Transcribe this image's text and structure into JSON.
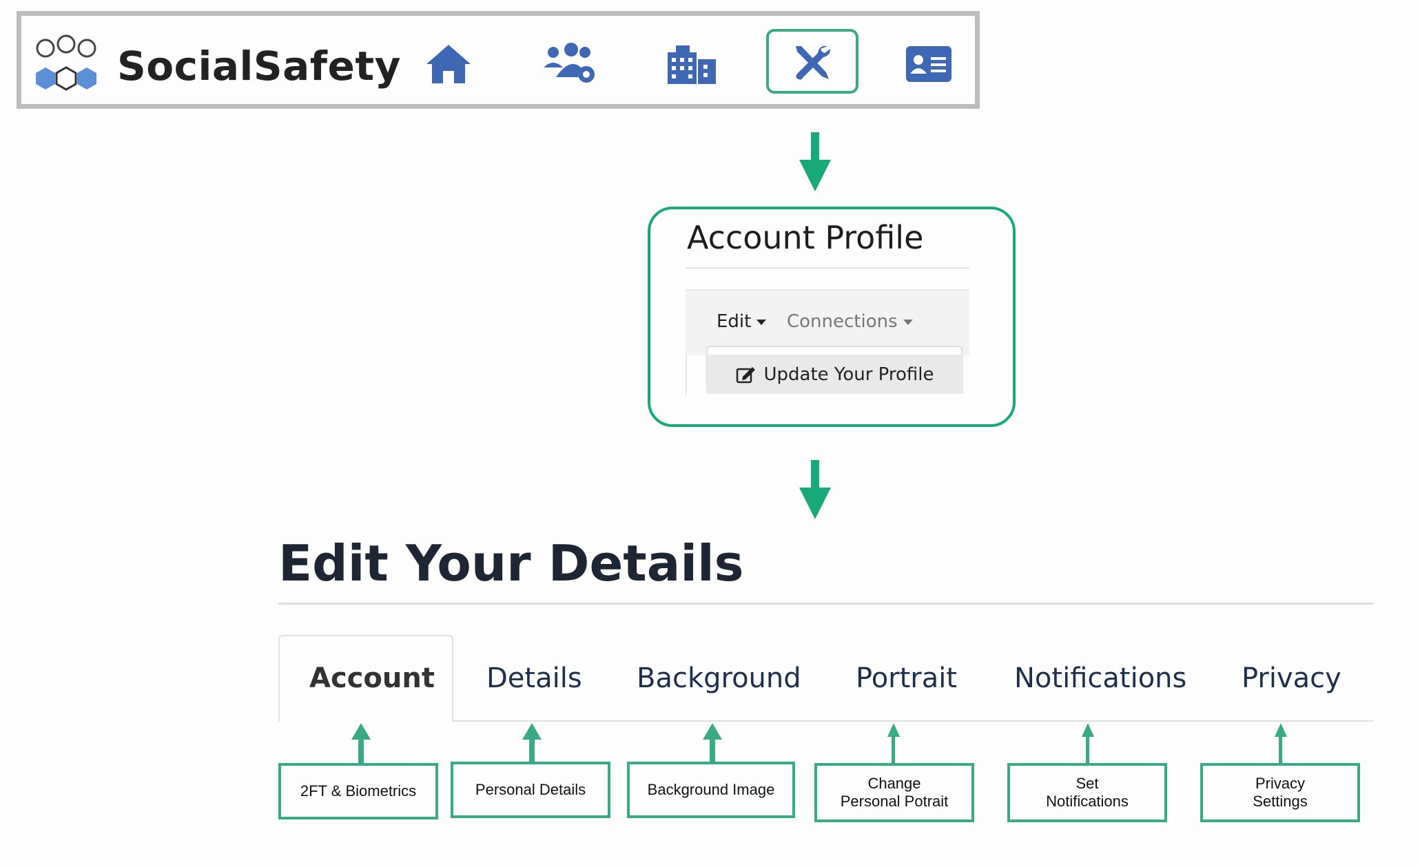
{
  "navbar": {
    "brand": "SocialSafety",
    "icons": [
      "logo-hexagons-icon",
      "home-icon",
      "users-gear-icon",
      "city-icon",
      "tools-icon",
      "id-card-icon"
    ],
    "selected": "tools-icon",
    "icon_color": "#3f68b4",
    "highlight_color": "#3aa985"
  },
  "account_profile": {
    "title": "Account Profile",
    "menu_edit": "Edit",
    "menu_connections": "Connections",
    "dropdown_item": "Update Your Profile",
    "border_color": "#18a97b"
  },
  "edit_details": {
    "title": "Edit Your Details",
    "tabs": [
      {
        "label": "Account",
        "active": true
      },
      {
        "label": "Details",
        "active": false
      },
      {
        "label": "Background",
        "active": false
      },
      {
        "label": "Portrait",
        "active": false
      },
      {
        "label": "Notifications",
        "active": false
      },
      {
        "label": "Privacy",
        "active": false
      }
    ],
    "features": [
      {
        "line1": "2FT & Biometrics",
        "line2": ""
      },
      {
        "line1": "Personal Details",
        "line2": ""
      },
      {
        "line1": "Background Image",
        "line2": ""
      },
      {
        "line1": "Change",
        "line2": "Personal Potrait"
      },
      {
        "line1": "Set",
        "line2": "Notifications"
      },
      {
        "line1": "Privacy",
        "line2": "Settings"
      }
    ],
    "arrow_color": "#3aa985"
  }
}
